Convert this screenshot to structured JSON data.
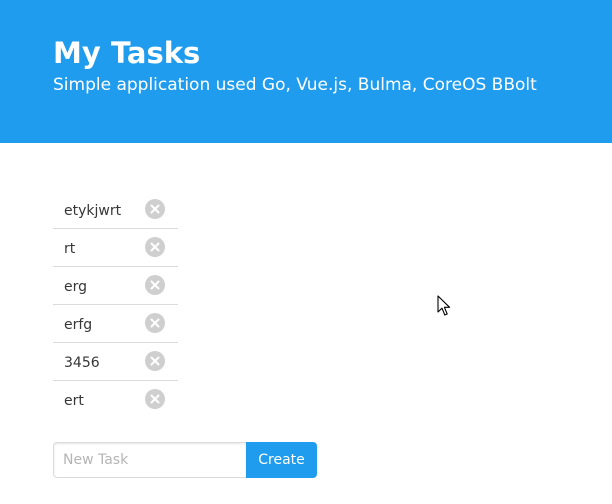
{
  "header": {
    "title": "My Tasks",
    "subtitle": "Simple application used Go, Vue.js, Bulma, CoreOS BBolt"
  },
  "tasks": [
    {
      "label": "etykjwrt"
    },
    {
      "label": "rt"
    },
    {
      "label": "erg"
    },
    {
      "label": "erfg"
    },
    {
      "label": "3456"
    },
    {
      "label": "ert"
    }
  ],
  "new_task": {
    "placeholder": "New Task",
    "value": "",
    "create_label": "Create"
  },
  "icons": {
    "delete": "close-icon",
    "cursor": "mouse-pointer-icon"
  },
  "colors": {
    "brand": "#209cee",
    "delete_button": "#cfcfcf",
    "divider": "#dbdbdb",
    "text": "#363636"
  }
}
